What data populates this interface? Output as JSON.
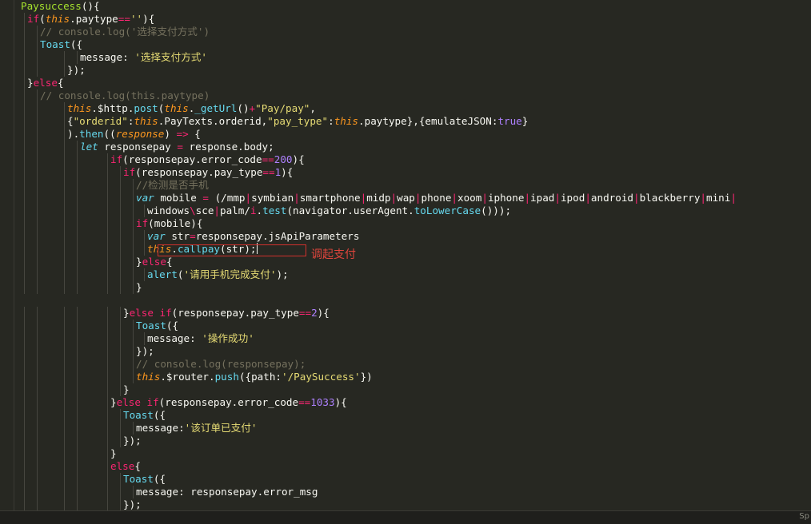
{
  "colors": {
    "background": "#272822",
    "keyword": "#f92672",
    "function": "#66d9ef",
    "string": "#e6db74",
    "number": "#ae81ff",
    "comment": "#75715e",
    "this": "#fd971f",
    "annotation": "#e0453c"
  },
  "code": [
    {
      "indent": 0,
      "parts": [
        [
          "t-green",
          "Paysuccess"
        ],
        [
          "t-id",
          "(){"
        ]
      ]
    },
    {
      "indent": 1,
      "parts": [
        [
          "t-kw",
          "if"
        ],
        [
          "t-id",
          "("
        ],
        [
          "t-this",
          "this"
        ],
        [
          "t-id",
          ".paytype"
        ],
        [
          "t-kw",
          "=="
        ],
        [
          "t-str",
          "''"
        ],
        [
          "t-id",
          "){"
        ]
      ]
    },
    {
      "indent": 2,
      "parts": [
        [
          "t-cm",
          "// console.log('选择支付方式')"
        ]
      ]
    },
    {
      "indent": 2,
      "parts": [
        [
          "t-fn",
          "Toast"
        ],
        [
          "t-id",
          "({"
        ]
      ]
    },
    {
      "indent": 4,
      "parts": [
        [
          "t-id",
          "message: "
        ],
        [
          "t-str",
          "'选择支付方式'"
        ]
      ]
    },
    {
      "indent": 3,
      "parts": [
        [
          "t-id",
          "});"
        ]
      ]
    },
    {
      "indent": 1,
      "parts": [
        [
          "t-id",
          "}"
        ],
        [
          "t-kw",
          "else"
        ],
        [
          "t-id",
          "{"
        ]
      ]
    },
    {
      "indent": 2,
      "parts": [
        [
          "t-cm",
          "// console.log(this.paytype)"
        ]
      ]
    },
    {
      "indent": 3,
      "parts": [
        [
          "t-this",
          "this"
        ],
        [
          "t-id",
          ".$http."
        ],
        [
          "t-fn",
          "post"
        ],
        [
          "t-id",
          "("
        ],
        [
          "t-this",
          "this"
        ],
        [
          "t-id",
          "."
        ],
        [
          "t-fn",
          "_getUrl"
        ],
        [
          "t-id",
          "()"
        ],
        [
          "t-kw",
          "+"
        ],
        [
          "t-str",
          "\"Pay/pay\""
        ],
        [
          "t-id",
          ","
        ]
      ]
    },
    {
      "indent": 3,
      "parts": [
        [
          "t-id",
          "{"
        ],
        [
          "t-str",
          "\"orderid\""
        ],
        [
          "t-id",
          ":"
        ],
        [
          "t-this",
          "this"
        ],
        [
          "t-id",
          ".PayTexts.orderid,"
        ],
        [
          "t-str",
          "\"pay_type\""
        ],
        [
          "t-id",
          ":"
        ],
        [
          "t-this",
          "this"
        ],
        [
          "t-id",
          ".paytype},{emulateJSON:"
        ],
        [
          "t-num",
          "true"
        ],
        [
          "t-id",
          "}"
        ]
      ]
    },
    {
      "indent": 3,
      "parts": [
        [
          "t-id",
          ")."
        ],
        [
          "t-fn",
          "then"
        ],
        [
          "t-id",
          "(("
        ],
        [
          "t-param",
          "response"
        ],
        [
          "t-id",
          ") "
        ],
        [
          "t-kw",
          "=>"
        ],
        [
          "t-id",
          " {"
        ]
      ]
    },
    {
      "indent": 4,
      "parts": [
        [
          "t-var",
          "let"
        ],
        [
          "t-id",
          " responsepay "
        ],
        [
          "t-kw",
          "="
        ],
        [
          "t-id",
          " response.body;"
        ]
      ]
    },
    {
      "indent": 5,
      "parts": [
        [
          "t-kw",
          "if"
        ],
        [
          "t-id",
          "(responsepay.error_code"
        ],
        [
          "t-kw",
          "=="
        ],
        [
          "t-num",
          "200"
        ],
        [
          "t-id",
          "){"
        ]
      ]
    },
    {
      "indent": 6,
      "parts": [
        [
          "t-kw",
          "if"
        ],
        [
          "t-id",
          "(responsepay.pay_type"
        ],
        [
          "t-kw",
          "=="
        ],
        [
          "t-num",
          "1"
        ],
        [
          "t-id",
          "){"
        ]
      ]
    },
    {
      "indent": 7,
      "parts": [
        [
          "t-cm",
          "//检测是否手机"
        ]
      ]
    },
    {
      "indent": 7,
      "parts": [
        [
          "t-var",
          "var"
        ],
        [
          "t-id",
          " mobile "
        ],
        [
          "t-kw",
          "="
        ],
        [
          "t-id",
          " (/mmp"
        ],
        [
          "t-kw",
          "|"
        ],
        [
          "t-id",
          "symbian"
        ],
        [
          "t-kw",
          "|"
        ],
        [
          "t-id",
          "smartphone"
        ],
        [
          "t-kw",
          "|"
        ],
        [
          "t-id",
          "midp"
        ],
        [
          "t-kw",
          "|"
        ],
        [
          "t-id",
          "wap"
        ],
        [
          "t-kw",
          "|"
        ],
        [
          "t-id",
          "phone"
        ],
        [
          "t-kw",
          "|"
        ],
        [
          "t-id",
          "xoom"
        ],
        [
          "t-kw",
          "|"
        ],
        [
          "t-id",
          "iphone"
        ],
        [
          "t-kw",
          "|"
        ],
        [
          "t-id",
          "ipad"
        ],
        [
          "t-kw",
          "|"
        ],
        [
          "t-id",
          "ipod"
        ],
        [
          "t-kw",
          "|"
        ],
        [
          "t-id",
          "android"
        ],
        [
          "t-kw",
          "|"
        ],
        [
          "t-id",
          "blackberry"
        ],
        [
          "t-kw",
          "|"
        ],
        [
          "t-id",
          "mini"
        ],
        [
          "t-kw",
          "|"
        ]
      ]
    },
    {
      "indent": 8,
      "parts": [
        [
          "t-id",
          "windows"
        ],
        [
          "t-kw",
          "\\"
        ],
        [
          "t-id",
          "sce"
        ],
        [
          "t-kw",
          "|"
        ],
        [
          "t-id",
          "palm/"
        ],
        [
          "t-kw",
          "i"
        ],
        [
          "t-id",
          "."
        ],
        [
          "t-fn",
          "test"
        ],
        [
          "t-id",
          "(navigator.userAgent."
        ],
        [
          "t-fn",
          "toLowerCase"
        ],
        [
          "t-id",
          "()));"
        ]
      ]
    },
    {
      "indent": 7,
      "parts": [
        [
          "t-kw",
          "if"
        ],
        [
          "t-id",
          "(mobile){"
        ]
      ]
    },
    {
      "indent": 8,
      "parts": [
        [
          "t-var",
          "var"
        ],
        [
          "t-id",
          " str"
        ],
        [
          "t-kw",
          "="
        ],
        [
          "t-id",
          "responsepay.jsApiParameters"
        ]
      ]
    },
    {
      "indent": 8,
      "parts": [
        [
          "t-this",
          "this"
        ],
        [
          "t-id",
          "."
        ],
        [
          "t-fn",
          "callpay"
        ],
        [
          "t-id",
          "(str);"
        ]
      ],
      "cursor": true
    },
    {
      "indent": 7,
      "parts": [
        [
          "t-id",
          "}"
        ],
        [
          "t-kw",
          "else"
        ],
        [
          "t-id",
          "{"
        ]
      ]
    },
    {
      "indent": 8,
      "parts": [
        [
          "t-fn",
          "alert"
        ],
        [
          "t-id",
          "("
        ],
        [
          "t-str",
          "'请用手机完成支付'"
        ],
        [
          "t-id",
          ");"
        ]
      ]
    },
    {
      "indent": 7,
      "parts": [
        [
          "t-id",
          "}"
        ]
      ]
    },
    {
      "indent": 0,
      "parts": []
    },
    {
      "indent": 6,
      "parts": [
        [
          "t-id",
          "}"
        ],
        [
          "t-kw",
          "else if"
        ],
        [
          "t-id",
          "(responsepay.pay_type"
        ],
        [
          "t-kw",
          "=="
        ],
        [
          "t-num",
          "2"
        ],
        [
          "t-id",
          "){"
        ]
      ]
    },
    {
      "indent": 7,
      "parts": [
        [
          "t-fn",
          "Toast"
        ],
        [
          "t-id",
          "({"
        ]
      ]
    },
    {
      "indent": 8,
      "parts": [
        [
          "t-id",
          "message: "
        ],
        [
          "t-str",
          "'操作成功'"
        ]
      ]
    },
    {
      "indent": 7,
      "parts": [
        [
          "t-id",
          "});"
        ]
      ]
    },
    {
      "indent": 7,
      "parts": [
        [
          "t-cm",
          "// console.log(responsepay);"
        ]
      ]
    },
    {
      "indent": 7,
      "parts": [
        [
          "t-this",
          "this"
        ],
        [
          "t-id",
          ".$router."
        ],
        [
          "t-fn",
          "push"
        ],
        [
          "t-id",
          "({path:"
        ],
        [
          "t-str",
          "'/PaySuccess'"
        ],
        [
          "t-id",
          "})"
        ]
      ]
    },
    {
      "indent": 6,
      "parts": [
        [
          "t-id",
          "}"
        ]
      ]
    },
    {
      "indent": 5,
      "parts": [
        [
          "t-id",
          "}"
        ],
        [
          "t-kw",
          "else if"
        ],
        [
          "t-id",
          "(responsepay.error_code"
        ],
        [
          "t-kw",
          "=="
        ],
        [
          "t-num",
          "1033"
        ],
        [
          "t-id",
          "){"
        ]
      ]
    },
    {
      "indent": 6,
      "parts": [
        [
          "t-fn",
          "Toast"
        ],
        [
          "t-id",
          "({"
        ]
      ]
    },
    {
      "indent": 7,
      "parts": [
        [
          "t-id",
          "message:"
        ],
        [
          "t-str",
          "'该订单已支付'"
        ]
      ]
    },
    {
      "indent": 6,
      "parts": [
        [
          "t-id",
          "});"
        ]
      ]
    },
    {
      "indent": 5,
      "parts": [
        [
          "t-id",
          "}"
        ]
      ]
    },
    {
      "indent": 5,
      "parts": [
        [
          "t-kw",
          "else"
        ],
        [
          "t-id",
          "{"
        ]
      ]
    },
    {
      "indent": 6,
      "parts": [
        [
          "t-fn",
          "Toast"
        ],
        [
          "t-id",
          "({"
        ]
      ]
    },
    {
      "indent": 7,
      "parts": [
        [
          "t-id",
          "message: responsepay.error_msg"
        ]
      ]
    },
    {
      "indent": 6,
      "parts": [
        [
          "t-id",
          "});"
        ]
      ]
    }
  ],
  "annotation": {
    "text": "调起支付"
  },
  "statusbar": {
    "right_text": "Sp"
  }
}
